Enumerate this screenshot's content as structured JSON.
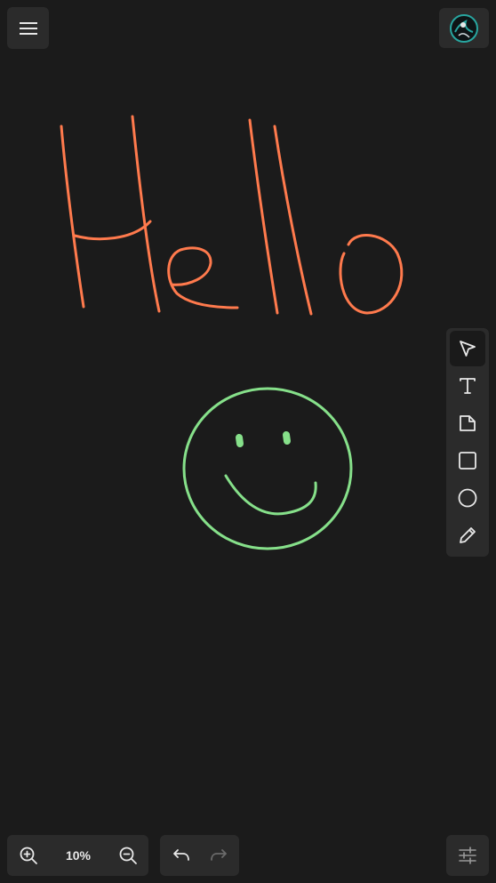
{
  "app": {
    "canvas_bg": "#1b1b1b",
    "panel_bg": "#2b2b2b"
  },
  "menu": {
    "icon": "hamburger-menu-icon"
  },
  "avatar": {
    "icon": "user-avatar-icon",
    "accent": "#28a6a0"
  },
  "toolbar": {
    "active_tool": "select",
    "tools": [
      {
        "id": "select",
        "icon": "cursor-arrow-icon"
      },
      {
        "id": "text",
        "icon": "text-icon"
      },
      {
        "id": "note",
        "icon": "sticky-note-icon"
      },
      {
        "id": "rectangle",
        "icon": "square-icon"
      },
      {
        "id": "ellipse",
        "icon": "circle-icon"
      },
      {
        "id": "pencil",
        "icon": "pencil-icon"
      }
    ]
  },
  "zoom": {
    "level": "10%",
    "zoom_in_icon": "zoom-in-icon",
    "zoom_out_icon": "zoom-out-icon"
  },
  "history": {
    "undo_icon": "undo-icon",
    "redo_icon": "redo-icon",
    "redo_enabled": false
  },
  "settings": {
    "icon": "sliders-icon"
  },
  "drawing": {
    "hello_color": "#ff7a4d",
    "smiley_color": "#86e08a"
  }
}
